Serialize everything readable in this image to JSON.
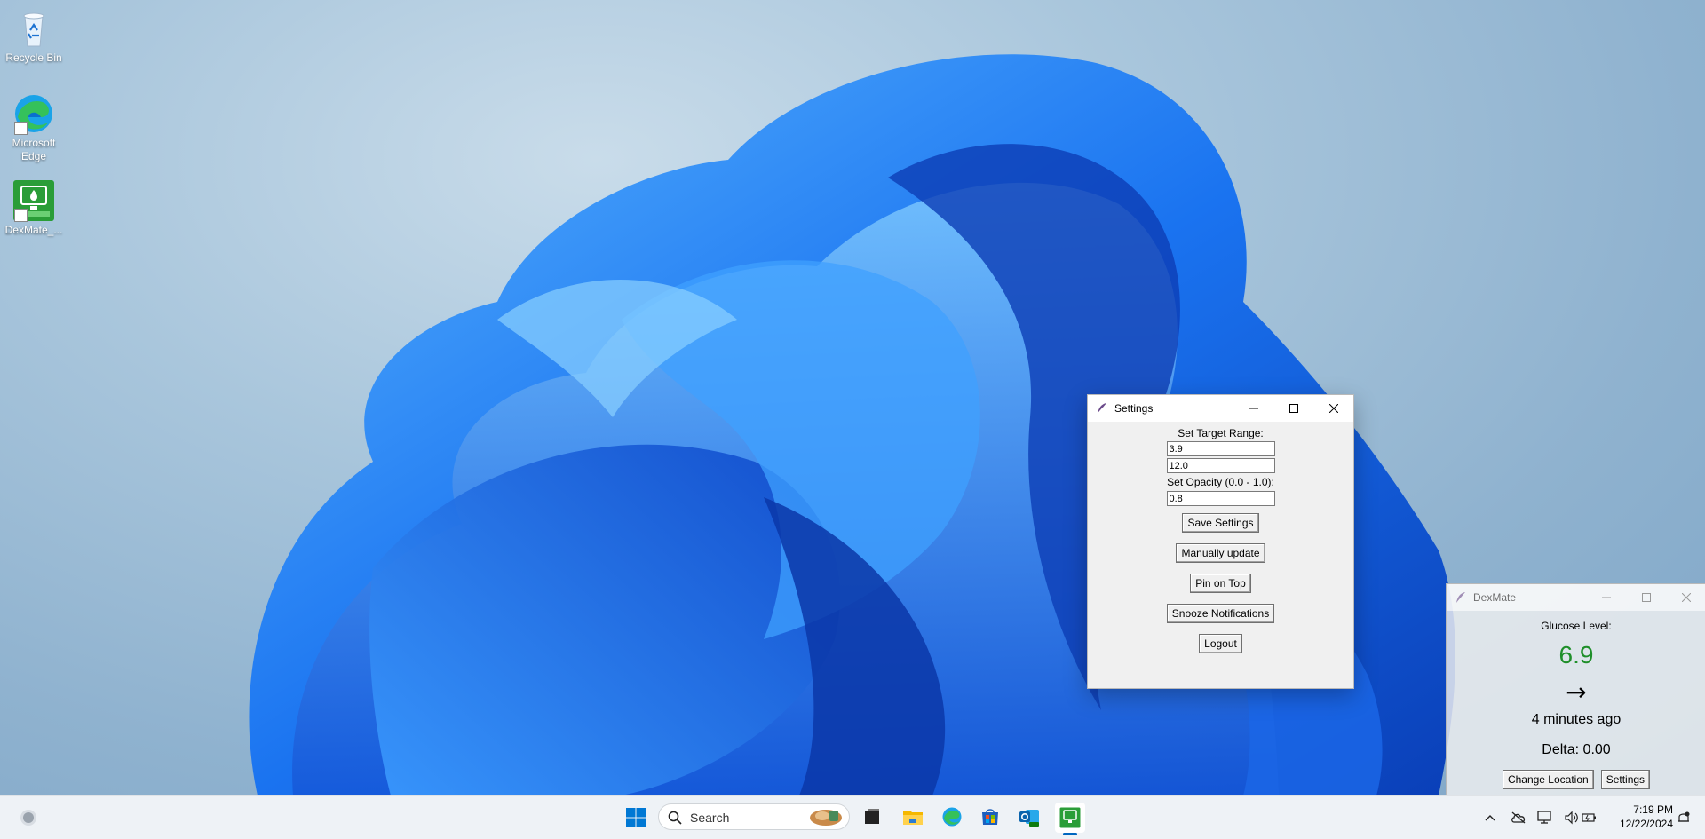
{
  "desktop": {
    "icons": [
      {
        "label": "Recycle Bin"
      },
      {
        "label": "Microsoft Edge"
      },
      {
        "label": "DexMate_..."
      }
    ]
  },
  "settings_window": {
    "title": "Settings",
    "target_range_label": "Set Target Range:",
    "target_low_value": "3.9",
    "target_high_value": "12.0",
    "opacity_label": "Set Opacity (0.0 - 1.0):",
    "opacity_value": "0.8",
    "buttons": {
      "save": "Save Settings",
      "manual_update": "Manually update",
      "pin_on_top": "Pin on Top",
      "snooze": "Snooze Notifications",
      "logout": "Logout"
    }
  },
  "dexmate_window": {
    "title": "DexMate",
    "glucose_label": "Glucose Level:",
    "glucose_value": "6.9",
    "trend_arrow": "→",
    "last_updated": "4 minutes ago",
    "delta": "Delta: 0.00",
    "buttons": {
      "change_location": "Change Location",
      "settings": "Settings"
    },
    "glucose_color": "#1f8f2a"
  },
  "taskbar": {
    "search_placeholder": "Search",
    "clock_time": "7:19 PM",
    "clock_date": "12/22/2024"
  },
  "colors": {
    "accent": "#0067c0",
    "dexmate_green": "#2a9d38"
  }
}
